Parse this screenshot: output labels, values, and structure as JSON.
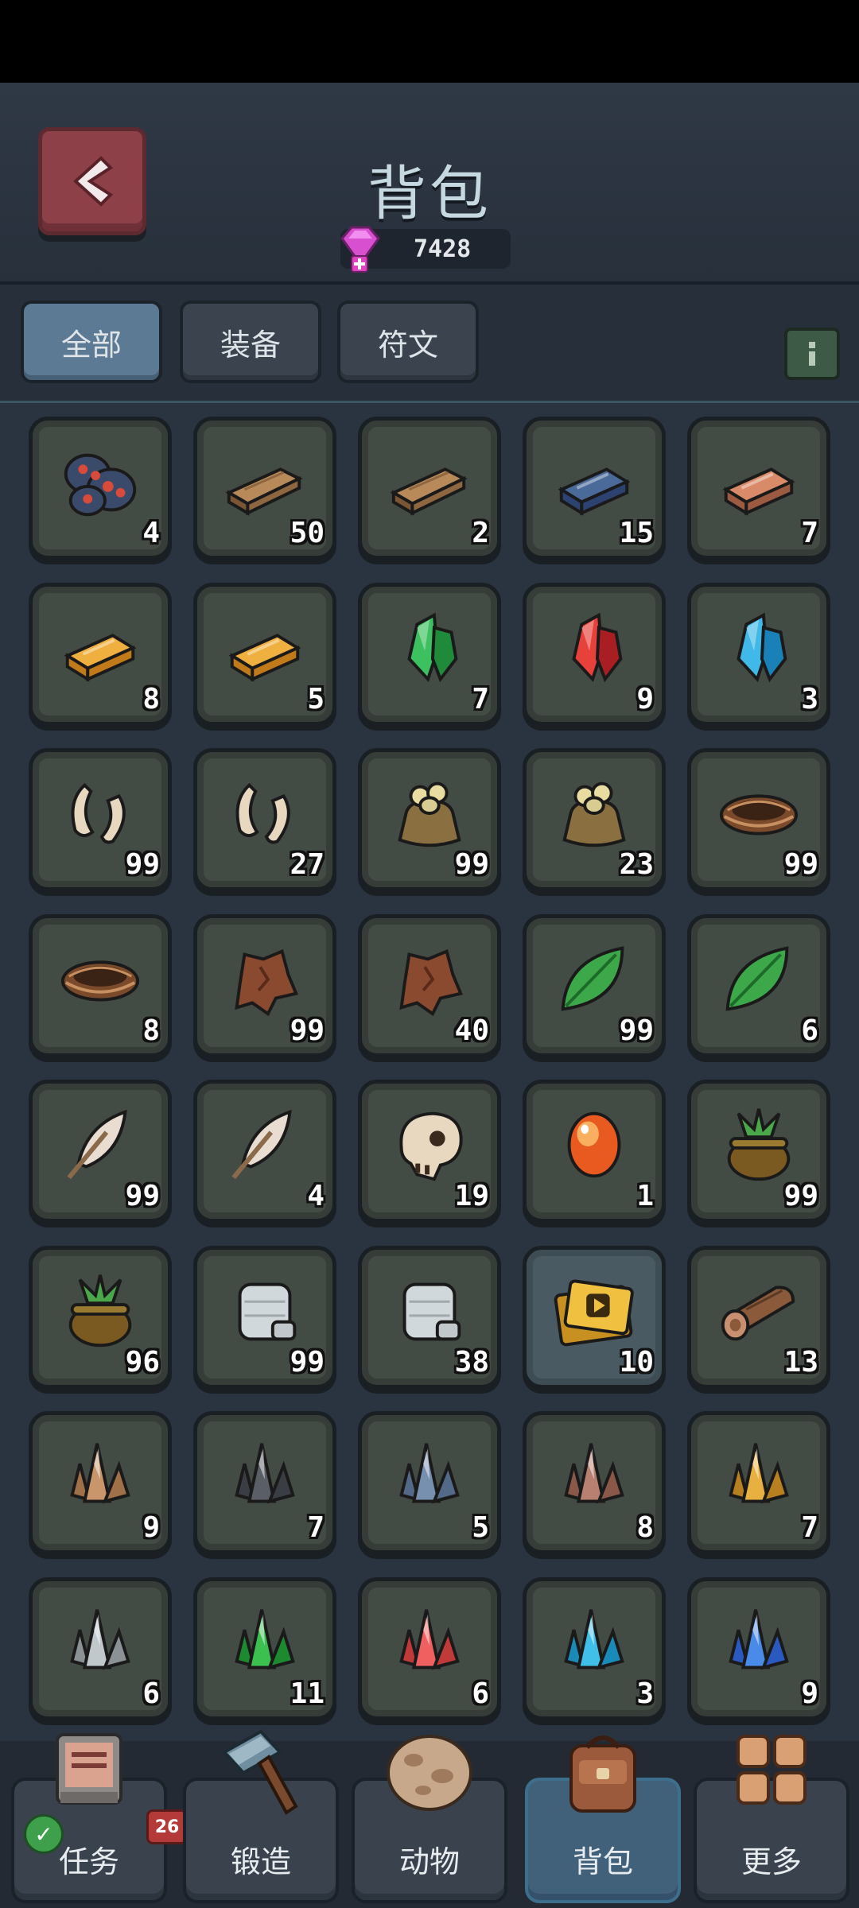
{
  "header": {
    "title": "背包",
    "currency_amount": "7428"
  },
  "filters": {
    "tabs": [
      {
        "label": "全部"
      },
      {
        "label": "装备"
      },
      {
        "label": "符文"
      }
    ]
  },
  "items": [
    {
      "icon": "ore-cluster-icon",
      "count": "4"
    },
    {
      "icon": "wood-plank-icon",
      "count": "50"
    },
    {
      "icon": "wood-plank-icon",
      "count": "2"
    },
    {
      "icon": "iron-ingot-icon",
      "count": "15"
    },
    {
      "icon": "copper-ingot-icon",
      "count": "7"
    },
    {
      "icon": "gold-ingot-icon",
      "count": "8"
    },
    {
      "icon": "gold-ingot-icon",
      "count": "5"
    },
    {
      "icon": "green-crystal-icon",
      "count": "7"
    },
    {
      "icon": "red-crystal-icon",
      "count": "9"
    },
    {
      "icon": "blue-crystal-icon",
      "count": "3"
    },
    {
      "icon": "fang-icon",
      "count": "99"
    },
    {
      "icon": "fang-icon",
      "count": "27"
    },
    {
      "icon": "seed-sack-icon",
      "count": "99"
    },
    {
      "icon": "seed-sack-icon",
      "count": "23"
    },
    {
      "icon": "nest-icon",
      "count": "99"
    },
    {
      "icon": "nest-icon",
      "count": "8"
    },
    {
      "icon": "leather-hide-icon",
      "count": "99"
    },
    {
      "icon": "leather-hide-icon",
      "count": "40"
    },
    {
      "icon": "leaf-icon",
      "count": "99"
    },
    {
      "icon": "leaf-icon",
      "count": "6"
    },
    {
      "icon": "feather-icon",
      "count": "99"
    },
    {
      "icon": "feather-icon",
      "count": "4"
    },
    {
      "icon": "skull-icon",
      "count": "19"
    },
    {
      "icon": "orange-gem-icon",
      "count": "1"
    },
    {
      "icon": "plant-pot-icon",
      "count": "99"
    },
    {
      "icon": "plant-pot-icon",
      "count": "96"
    },
    {
      "icon": "thread-spool-icon",
      "count": "99"
    },
    {
      "icon": "thread-spool-icon",
      "count": "38"
    },
    {
      "icon": "video-ticket-icon",
      "count": "10"
    },
    {
      "icon": "log-icon",
      "count": "13"
    },
    {
      "icon": "tan-shard-icon",
      "count": "9"
    },
    {
      "icon": "dark-shard-icon",
      "count": "7"
    },
    {
      "icon": "steel-shard-icon",
      "count": "5"
    },
    {
      "icon": "rose-shard-icon",
      "count": "8"
    },
    {
      "icon": "gold-shard-icon",
      "count": "7"
    },
    {
      "icon": "silver-shard-icon",
      "count": "6"
    },
    {
      "icon": "emerald-shard-icon",
      "count": "11"
    },
    {
      "icon": "ruby-shard-icon",
      "count": "6"
    },
    {
      "icon": "aqua-shard-icon",
      "count": "3"
    },
    {
      "icon": "sapphire-shard-icon",
      "count": "9"
    }
  ],
  "nav": {
    "tasks": {
      "label": "任务",
      "badge": "26"
    },
    "forge": {
      "label": "锻造"
    },
    "animals": {
      "label": "动物"
    },
    "bag": {
      "label": "背包"
    },
    "more": {
      "label": "更多"
    }
  },
  "colors": {
    "accent": "#5c7a93",
    "back_button": "#8e4048",
    "badge": "#b43a3a"
  }
}
